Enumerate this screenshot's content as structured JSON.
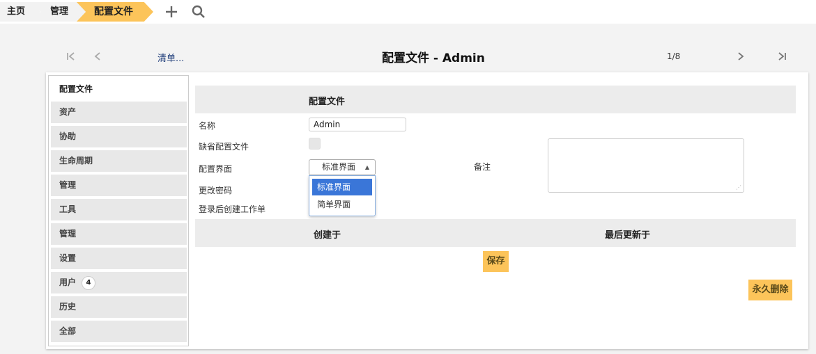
{
  "breadcrumb": {
    "home": "主页",
    "admin": "管理",
    "active": "配置文件"
  },
  "toolbar": {
    "add_icon": "plus-icon",
    "search_icon": "search-icon"
  },
  "navigation": {
    "back_link": "清单...",
    "title": "配置文件 - Admin",
    "pager": "1/8"
  },
  "sidebar": {
    "items": [
      {
        "label": "配置文件",
        "active": true
      },
      {
        "label": "资产"
      },
      {
        "label": "协助"
      },
      {
        "label": "生命周期"
      },
      {
        "label": "管理"
      },
      {
        "label": "工具"
      },
      {
        "label": "管理"
      },
      {
        "label": "设置"
      },
      {
        "label": "用户",
        "badge": "4"
      },
      {
        "label": "历史"
      },
      {
        "label": "全部"
      }
    ]
  },
  "form": {
    "section_title": "配置文件",
    "name_label": "名称",
    "name_value": "Admin",
    "default_label": "缺省配置文件",
    "interface_label": "配置界面",
    "interface_value": "标准界面",
    "interface_options": [
      "标准界面",
      "简单界面"
    ],
    "password_label": "更改密码",
    "ticket_label": "登录后创建工作单",
    "comment_label": "备注",
    "created_label": "创建于",
    "updated_label": "最后更新于"
  },
  "buttons": {
    "save": "保存",
    "delete": "永久删除"
  },
  "colors": {
    "accent": "#fcc45a",
    "selected_option": "#3a76d8",
    "link": "#1f3d7a"
  }
}
